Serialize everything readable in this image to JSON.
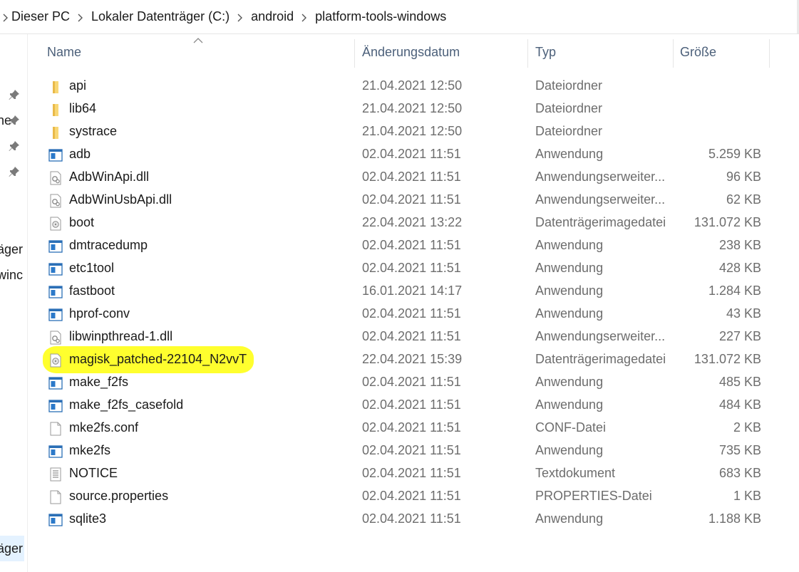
{
  "breadcrumb": [
    "Dieser PC",
    "Lokaler Datenträger (C:)",
    "android",
    "platform-tools-windows"
  ],
  "nav": {
    "fragments": [
      "ne",
      "äger",
      "winc",
      "äger"
    ]
  },
  "columns": {
    "name": "Name",
    "date": "Änderungsdatum",
    "type": "Typ",
    "size": "Größe"
  },
  "files": [
    {
      "name": "api",
      "date": "21.04.2021 12:50",
      "type": "Dateiordner",
      "size": "",
      "icon": "folder-icon"
    },
    {
      "name": "lib64",
      "date": "21.04.2021 12:50",
      "type": "Dateiordner",
      "size": "",
      "icon": "folder-icon"
    },
    {
      "name": "systrace",
      "date": "21.04.2021 12:50",
      "type": "Dateiordner",
      "size": "",
      "icon": "folder-icon"
    },
    {
      "name": "adb",
      "date": "02.04.2021 11:51",
      "type": "Anwendung",
      "size": "5.259 KB",
      "icon": "application-icon"
    },
    {
      "name": "AdbWinApi.dll",
      "date": "02.04.2021 11:51",
      "type": "Anwendungserweiter...",
      "size": "96 KB",
      "icon": "dll-icon"
    },
    {
      "name": "AdbWinUsbApi.dll",
      "date": "02.04.2021 11:51",
      "type": "Anwendungserweiter...",
      "size": "62 KB",
      "icon": "dll-icon"
    },
    {
      "name": "boot",
      "date": "22.04.2021 13:22",
      "type": "Datenträgerimagedatei",
      "size": "131.072 KB",
      "icon": "disc-image-icon"
    },
    {
      "name": "dmtracedump",
      "date": "02.04.2021 11:51",
      "type": "Anwendung",
      "size": "238 KB",
      "icon": "application-icon"
    },
    {
      "name": "etc1tool",
      "date": "02.04.2021 11:51",
      "type": "Anwendung",
      "size": "428 KB",
      "icon": "application-icon"
    },
    {
      "name": "fastboot",
      "date": "16.01.2021 14:17",
      "type": "Anwendung",
      "size": "1.284 KB",
      "icon": "application-icon"
    },
    {
      "name": "hprof-conv",
      "date": "02.04.2021 11:51",
      "type": "Anwendung",
      "size": "43 KB",
      "icon": "application-icon"
    },
    {
      "name": "libwinpthread-1.dll",
      "date": "02.04.2021 11:51",
      "type": "Anwendungserweiter...",
      "size": "227 KB",
      "icon": "dll-icon"
    },
    {
      "name": "magisk_patched-22104_N2vvT",
      "date": "22.04.2021 15:39",
      "type": "Datenträgerimagedatei",
      "size": "131.072 KB",
      "icon": "disc-image-icon",
      "highlighted": true
    },
    {
      "name": "make_f2fs",
      "date": "02.04.2021 11:51",
      "type": "Anwendung",
      "size": "485 KB",
      "icon": "application-icon"
    },
    {
      "name": "make_f2fs_casefold",
      "date": "02.04.2021 11:51",
      "type": "Anwendung",
      "size": "484 KB",
      "icon": "application-icon"
    },
    {
      "name": "mke2fs.conf",
      "date": "02.04.2021 11:51",
      "type": "CONF-Datei",
      "size": "2 KB",
      "icon": "blank-file-icon"
    },
    {
      "name": "mke2fs",
      "date": "02.04.2021 11:51",
      "type": "Anwendung",
      "size": "735 KB",
      "icon": "application-icon"
    },
    {
      "name": "NOTICE",
      "date": "02.04.2021 11:51",
      "type": "Textdokument",
      "size": "683 KB",
      "icon": "text-file-icon"
    },
    {
      "name": "source.properties",
      "date": "02.04.2021 11:51",
      "type": "PROPERTIES-Datei",
      "size": "1 KB",
      "icon": "blank-file-icon"
    },
    {
      "name": "sqlite3",
      "date": "02.04.2021 11:51",
      "type": "Anwendung",
      "size": "1.188 KB",
      "icon": "application-icon"
    }
  ],
  "colors": {
    "header_text": "#4c607a",
    "secondary_text": "#6d6d6d",
    "highlight": "#ffff2e",
    "folder": "#f8d775"
  }
}
